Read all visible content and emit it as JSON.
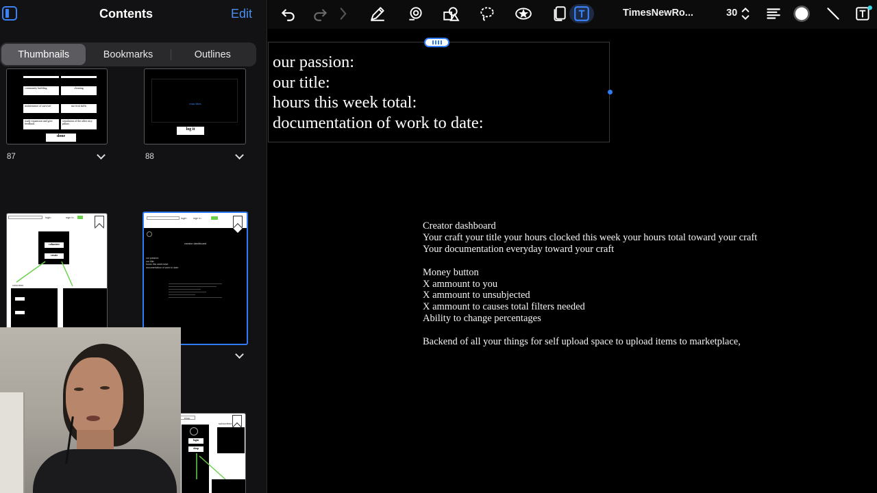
{
  "sidebar": {
    "title": "Contents",
    "edit_label": "Edit",
    "tabs": [
      {
        "label": "Thumbnails",
        "active": true
      },
      {
        "label": "Bookmarks",
        "active": false
      },
      {
        "label": "Outlines",
        "active": false
      }
    ],
    "pages": [
      {
        "number": "87",
        "buttons": [
          "community building",
          "cleaning",
          "maintenance of survival",
          "survival skills",
          "study expansion and give feedback",
          "simulation of the other ntry pillars"
        ],
        "done_label": "done"
      },
      {
        "number": "88",
        "link_text": "read titles",
        "button_label": "log it"
      },
      {
        "tabs": [
          "login",
          "sign in"
        ],
        "buttons": [
          "volunteer",
          "create"
        ],
        "label": "volunteer"
      },
      {
        "tabs": [
          "login",
          "sign in"
        ],
        "heading": "creator dashboard",
        "lines": [
          "our passion:",
          "our title:",
          "hours this week total:",
          "documentation of work to date:"
        ]
      },
      {
        "tabs": [
          "shop"
        ],
        "buttons": [
          "login",
          "shop"
        ],
        "label": "subscribed"
      }
    ]
  },
  "toolbar": {
    "font_name": "TimesNewRo...",
    "font_size": "30",
    "accent": "#3b82f6",
    "icons": [
      "undo-icon",
      "redo-icon",
      "pen-icon",
      "eraser-icon",
      "shapes-icon",
      "lasso-icon",
      "sticker-icon",
      "pages-icon",
      "text-tool-icon",
      "font-size-stepper-icon",
      "align-icon",
      "color-swatch-icon",
      "line-icon",
      "text-format-icon"
    ]
  },
  "canvas": {
    "textbox_lines": [
      "our passion:",
      "our title:",
      "hours this week total:",
      "documentation of work to date:"
    ],
    "body_lines": [
      "Creator dashboard",
      "Your craft your title your hours clocked this week your hours total toward your craft",
      "Your documentation everyday toward your craft",
      "",
      "Money button",
      "X ammount to you",
      "X ammount to unsubjected",
      "X ammount to causes total filters needed",
      "Ability to change percentages",
      "",
      "Backend of all your things for self upload space to upload items to marketplace,"
    ]
  }
}
